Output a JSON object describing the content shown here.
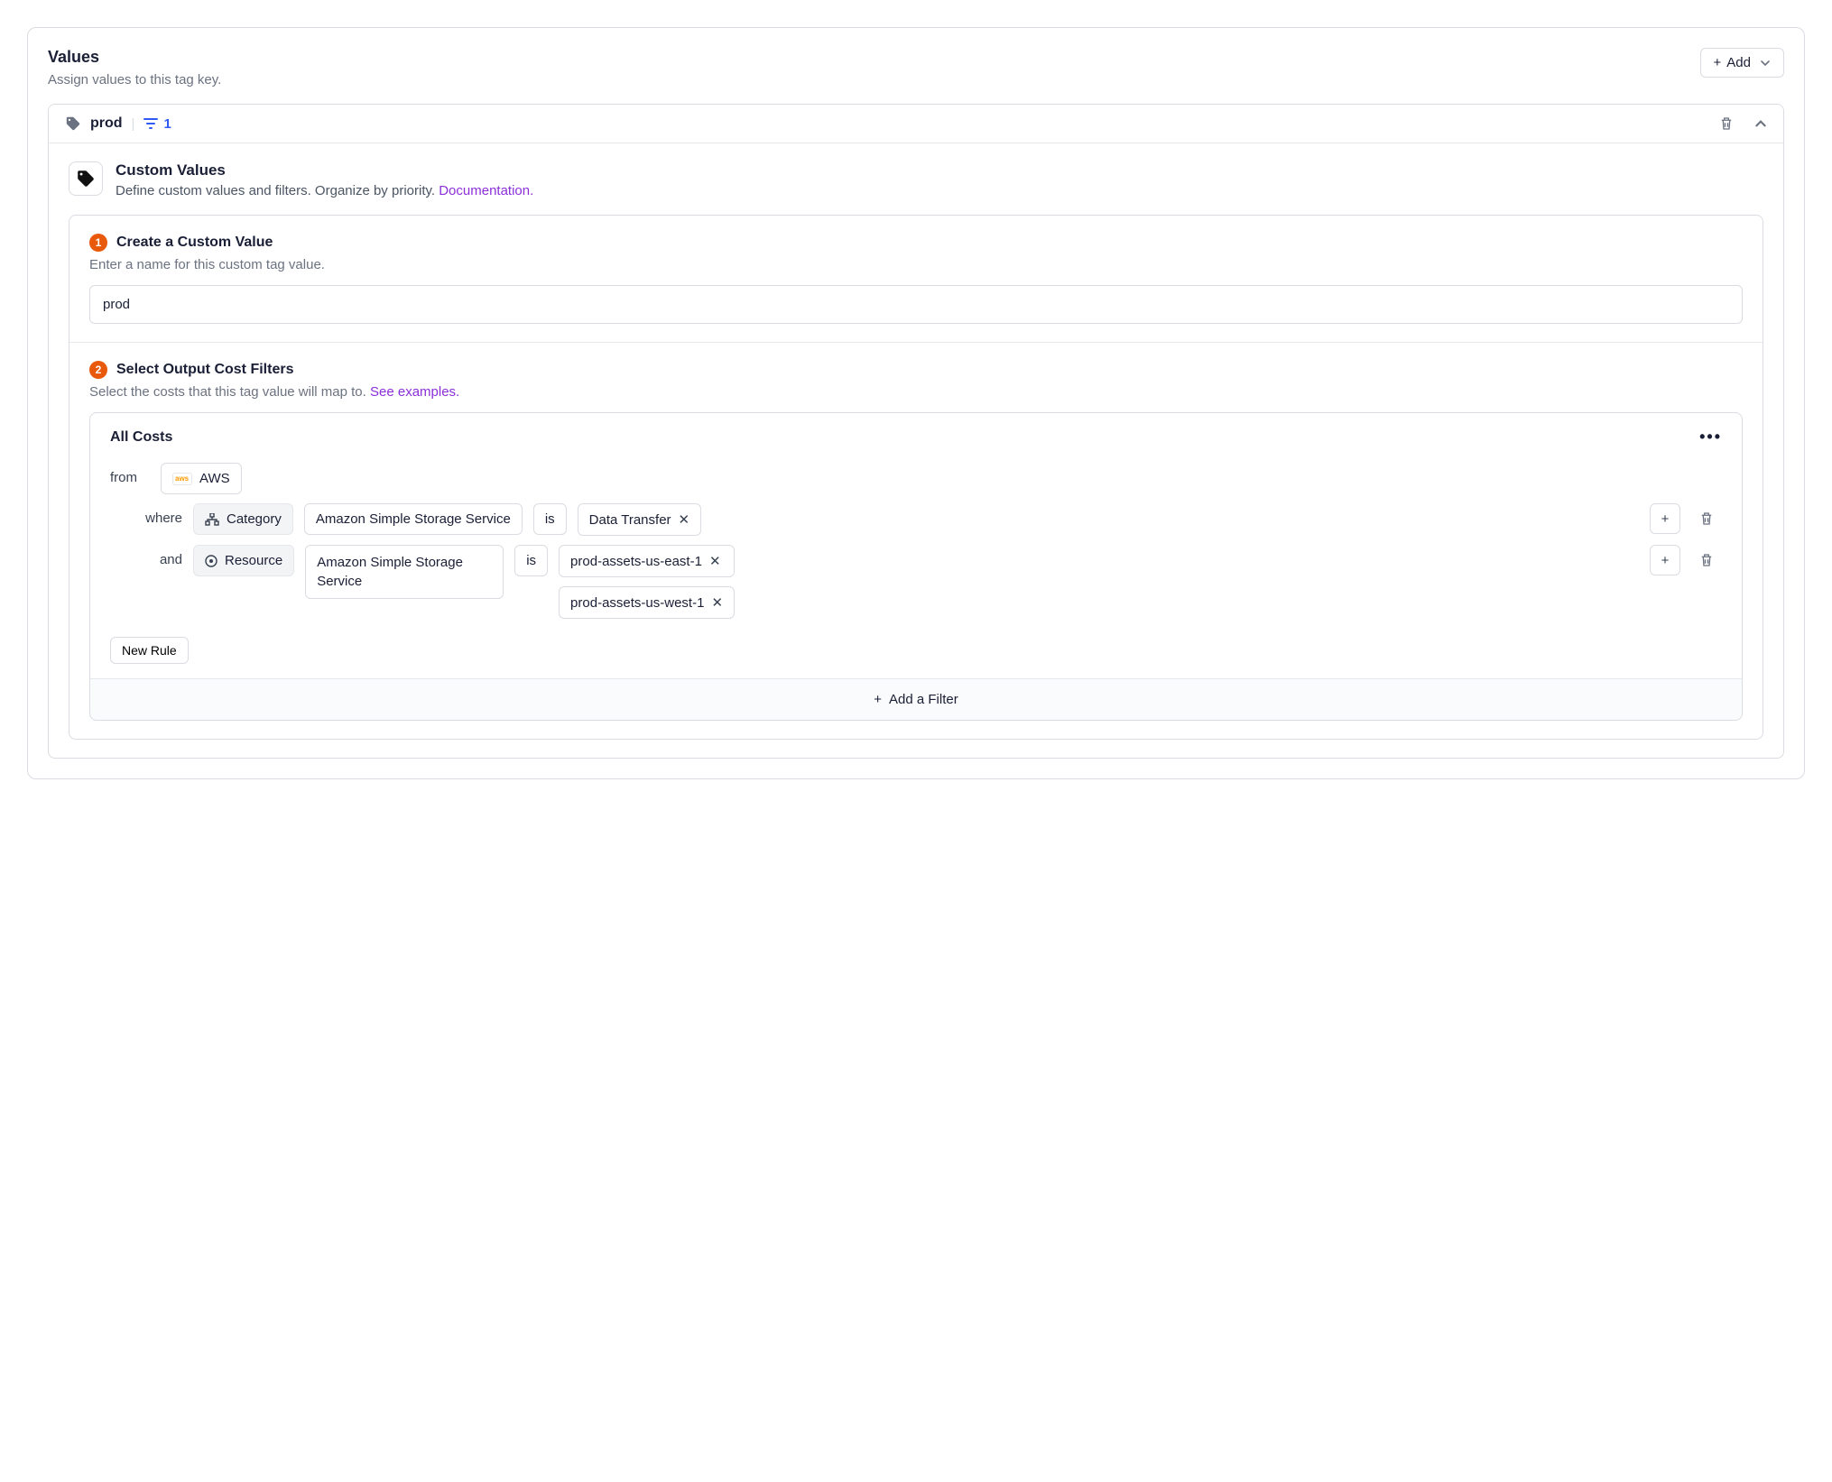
{
  "header": {
    "title": "Values",
    "subtitle": "Assign values to this tag key.",
    "add_label": "Add"
  },
  "value": {
    "name": "prod",
    "filter_count": "1"
  },
  "custom": {
    "title": "Custom Values",
    "subtitle_prefix": "Define custom values and filters. Organize by priority. ",
    "doc_link": "Documentation."
  },
  "step1": {
    "num": "1",
    "title": "Create a Custom Value",
    "desc": "Enter a name for this custom tag value.",
    "input_value": "prod"
  },
  "step2": {
    "num": "2",
    "title": "Select Output Cost Filters",
    "desc_prefix": "Select the costs that this tag value will map to. ",
    "examples_link": "See examples."
  },
  "filters": {
    "title": "All Costs",
    "from_kw": "from",
    "provider": "AWS",
    "where_kw": "where",
    "and_kw": "and",
    "is_op": "is",
    "rule1": {
      "field": "Category",
      "context": "Amazon Simple Storage Service",
      "value": "Data Transfer"
    },
    "rule2": {
      "field": "Resource",
      "context": "Amazon Simple Storage Service",
      "value1": "prod-assets-us-east-1",
      "value2": "prod-assets-us-west-1"
    },
    "new_rule": "New Rule",
    "add_filter": "Add a Filter"
  }
}
